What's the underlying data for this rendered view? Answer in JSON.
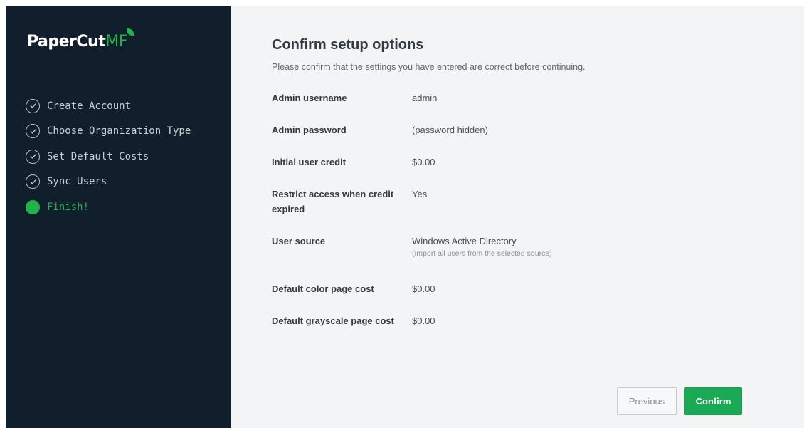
{
  "brand": {
    "name": "PaperCut",
    "suffix": "MF",
    "accent": "#22b24c"
  },
  "steps": [
    {
      "label": "Create Account",
      "state": "done",
      "icon": "check-circle-icon"
    },
    {
      "label": "Choose Organization Type",
      "state": "done",
      "icon": "check-circle-icon"
    },
    {
      "label": "Set Default Costs",
      "state": "done",
      "icon": "check-circle-icon"
    },
    {
      "label": "Sync Users",
      "state": "done",
      "icon": "check-circle-icon"
    },
    {
      "label": "Finish!",
      "state": "active",
      "icon": "active-step-dot-icon"
    }
  ],
  "main": {
    "title": "Confirm setup options",
    "subtitle": "Please confirm that the settings you have entered are correct before continuing.",
    "settings": [
      {
        "key": "Admin username",
        "value": "admin"
      },
      {
        "key": "Admin password",
        "value": "(password hidden)"
      },
      {
        "key": "Initial user credit",
        "value": "$0.00"
      },
      {
        "key": "Restrict access when credit expired",
        "value": "Yes"
      },
      {
        "key": "User source",
        "value": "Windows Active Directory",
        "note": "(Import all users from the selected source)"
      },
      {
        "key": "Default color page cost",
        "value": "$0.00"
      },
      {
        "key": "Default grayscale page cost",
        "value": "$0.00"
      }
    ]
  },
  "buttons": {
    "previous": "Previous",
    "confirm": "Confirm"
  }
}
